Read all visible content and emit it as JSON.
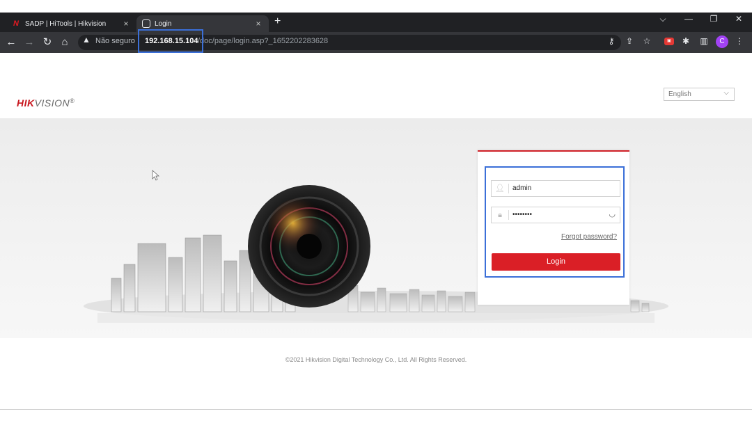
{
  "browser": {
    "tabs": [
      {
        "title": "SADP | HiTools | Hikvision",
        "favicon": "hikvision-h-icon"
      },
      {
        "title": "Login",
        "favicon": "page-icon"
      }
    ],
    "close_glyph": "×",
    "new_tab_glyph": "+",
    "window_controls": {
      "menu": "⌵",
      "minimize": "—",
      "restore": "❐",
      "close": "✕"
    },
    "address": {
      "security_label": "Não seguro",
      "host": "192.168.15.104",
      "path": "/doc/page/login.asp?_1652202283628"
    },
    "profile_initial": "C"
  },
  "page": {
    "logo": {
      "part1": "HIK",
      "part2": "VISION",
      "mark": "®"
    },
    "language": "English",
    "login": {
      "username": "admin",
      "password_mask": "••••••••",
      "forgot_label": "Forgot password?",
      "login_label": "Login"
    },
    "footer": "©2021 Hikvision Digital Technology Co., Ltd. All Rights Reserved."
  },
  "colors": {
    "accent_red": "#da1f26",
    "highlight_blue": "#3b6fd8",
    "browser_dark": "#202124"
  }
}
